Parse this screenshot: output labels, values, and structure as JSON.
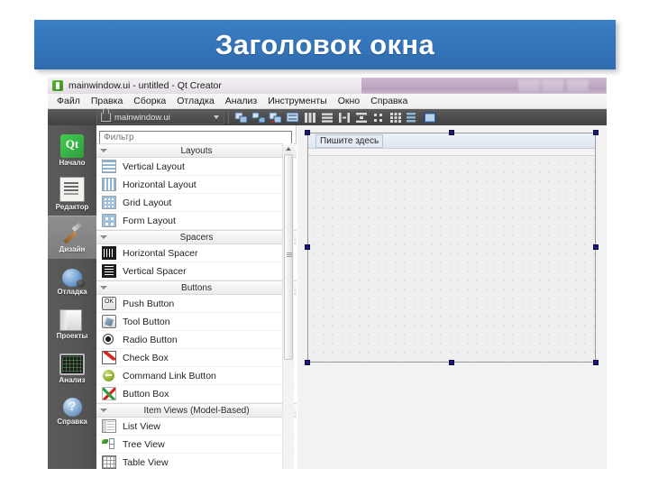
{
  "slide": {
    "banner_title": "Заголовок окна",
    "banner_color": "#3576bb"
  },
  "window": {
    "title": "mainwindow.ui - untitled - Qt Creator",
    "title_icon": "qt-logo-icon"
  },
  "menubar": {
    "items": [
      {
        "label": "Файл"
      },
      {
        "label": "Правка"
      },
      {
        "label": "Сборка"
      },
      {
        "label": "Отладка"
      },
      {
        "label": "Анализ"
      },
      {
        "label": "Инструменты"
      },
      {
        "label": "Окно"
      },
      {
        "label": "Справка"
      }
    ]
  },
  "toolbar": {
    "file_combo_value": "mainwindow.ui",
    "lock_icon": "unlocked-padlock-icon",
    "dropdown_icon": "chevron-down-icon",
    "buttons": [
      {
        "name": "edit-buddies-icon"
      },
      {
        "name": "edit-signals-slots-icon"
      },
      {
        "name": "edit-tab-order-icon"
      },
      {
        "name": "edit-widgets-icon"
      },
      {
        "name": "layout-horizontally-icon"
      },
      {
        "name": "layout-vertically-icon"
      },
      {
        "name": "layout-horizontal-splitter-icon"
      },
      {
        "name": "layout-vertical-splitter-icon"
      },
      {
        "name": "layout-in-form-icon"
      },
      {
        "name": "layout-in-grid-icon"
      },
      {
        "name": "break-layout-icon"
      },
      {
        "name": "adjust-size-icon"
      }
    ]
  },
  "modebar": {
    "items": [
      {
        "label": "Начало",
        "icon": "qt-welcome-icon",
        "active": false
      },
      {
        "label": "Редактор",
        "icon": "editor-icon",
        "active": false
      },
      {
        "label": "Дизайн",
        "icon": "design-brush-icon",
        "active": true
      },
      {
        "label": "Отладка",
        "icon": "debug-bug-icon",
        "active": false
      },
      {
        "label": "Проекты",
        "icon": "projects-folder-icon",
        "active": false
      },
      {
        "label": "Анализ",
        "icon": "analyze-chart-icon",
        "active": false
      },
      {
        "label": "Справка",
        "icon": "help-question-icon",
        "active": false
      }
    ]
  },
  "widgetbox": {
    "filter_placeholder": "Фильтр",
    "filter_value": "",
    "groups": [
      {
        "title": "Layouts",
        "items": [
          {
            "label": "Vertical Layout",
            "icon": "vertical-layout-icon",
            "icon_class": "wi-vlayout"
          },
          {
            "label": "Horizontal Layout",
            "icon": "horizontal-layout-icon",
            "icon_class": "wi-hlayout"
          },
          {
            "label": "Grid Layout",
            "icon": "grid-layout-icon",
            "icon_class": "wi-grid"
          },
          {
            "label": "Form Layout",
            "icon": "form-layout-icon",
            "icon_class": "wi-form"
          }
        ]
      },
      {
        "title": "Spacers",
        "items": [
          {
            "label": "Horizontal Spacer",
            "icon": "horizontal-spacer-icon",
            "icon_class": "wi-hspacer"
          },
          {
            "label": "Vertical Spacer",
            "icon": "vertical-spacer-icon",
            "icon_class": "wi-vspacer"
          }
        ]
      },
      {
        "title": "Buttons",
        "items": [
          {
            "label": "Push Button",
            "icon": "push-button-icon",
            "icon_class": "wi-push"
          },
          {
            "label": "Tool Button",
            "icon": "tool-button-icon",
            "icon_class": "wi-tool"
          },
          {
            "label": "Radio Button",
            "icon": "radio-button-icon",
            "icon_class": "wi-radio"
          },
          {
            "label": "Check Box",
            "icon": "check-box-icon",
            "icon_class": "wi-check"
          },
          {
            "label": "Command Link Button",
            "icon": "command-link-button-icon",
            "icon_class": "wi-cmdlink"
          },
          {
            "label": "Button Box",
            "icon": "button-box-icon",
            "icon_class": "wi-btnbox"
          }
        ]
      },
      {
        "title": "Item Views (Model-Based)",
        "items": [
          {
            "label": "List View",
            "icon": "list-view-icon",
            "icon_class": "wi-listview"
          },
          {
            "label": "Tree View",
            "icon": "tree-view-icon",
            "icon_class": "wi-treeview"
          },
          {
            "label": "Table View",
            "icon": "table-view-icon",
            "icon_class": "wi-tableview"
          }
        ]
      }
    ]
  },
  "form": {
    "menu_placeholder": "Пишите здесь",
    "selected": true
  }
}
